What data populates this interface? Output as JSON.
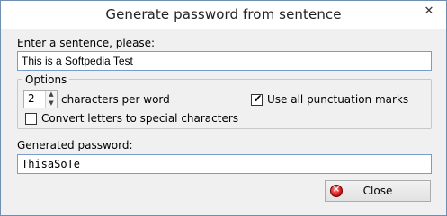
{
  "window": {
    "title": "Generate password from sentence",
    "close_glyph": "✕"
  },
  "sentence": {
    "label": "Enter a sentence, please:",
    "value": "This is a Softpedia Test"
  },
  "options": {
    "group_title": "Options",
    "chars_per_word_value": "2",
    "chars_per_word_label": "characters per word",
    "convert_special": {
      "label": "Convert letters to special characters",
      "checked": false
    },
    "use_punctuation": {
      "label": "Use all punctuation marks",
      "checked": true
    }
  },
  "generated": {
    "label": "Generated password:",
    "value": "ThisaSoTe"
  },
  "close_button": {
    "label": "Close",
    "icon": "close-circle-icon"
  }
}
